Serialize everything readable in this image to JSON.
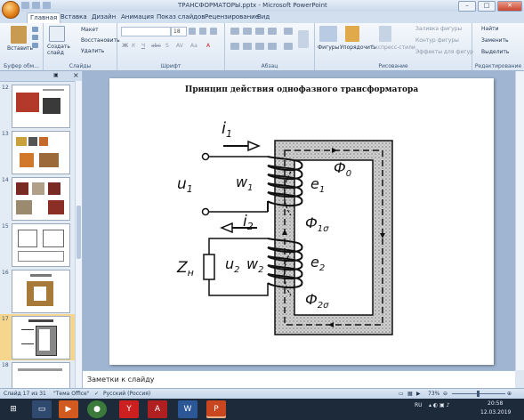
{
  "window": {
    "title": "ТРАНСФОРМАТОРЫ.pptx - Microsoft PowerPoint"
  },
  "tabs": [
    "Главная",
    "Вставка",
    "Дизайн",
    "Анимация",
    "Показ слайдов",
    "Рецензирование",
    "Вид"
  ],
  "ribbon": {
    "clipboard": {
      "paste": "Вставить",
      "group": "Буфер обм..."
    },
    "slides": {
      "create": "Создать слайд",
      "layout": "Макет",
      "reset": "Восстановить",
      "delete": "Удалить",
      "group": "Слайды"
    },
    "font": {
      "font_name": "",
      "font_size": "18",
      "group": "Шрифт"
    },
    "paragraph": {
      "group": "Абзац"
    },
    "drawing": {
      "shapes": "Фигуры",
      "arrange": "Упорядочить",
      "quick_styles": "Экспресс-стили",
      "fill": "Заливка фигуры",
      "outline": "Контур фигуры",
      "effects": "Эффекты для фигур",
      "group": "Рисование"
    },
    "editing": {
      "find": "Найти",
      "replace": "Заменить",
      "select": "Выделить",
      "group": "Редактирование"
    }
  },
  "slides_pane": {
    "items": [
      {
        "number": "12"
      },
      {
        "number": "13"
      },
      {
        "number": "14"
      },
      {
        "number": "15"
      },
      {
        "number": "16"
      },
      {
        "number": "17"
      },
      {
        "number": "18"
      }
    ]
  },
  "slide": {
    "title": "Принцип действия однофазного трансформатора",
    "labels": {
      "i1": "i",
      "i1_sub": "1",
      "u1": "u",
      "u1_sub": "1",
      "w1": "w",
      "w1_sub": "1",
      "e1": "e",
      "e1_sub": "1",
      "phi0": "Ф",
      "phi0_sub": "0",
      "phi1s": "Ф",
      "phi1s_sub": "1σ",
      "i2": "i",
      "i2_sub": "2",
      "zn": "Z",
      "zn_sub": "н",
      "u2": "u",
      "u2_sub": "2",
      "w2": "w",
      "w2_sub": "2",
      "e2": "e",
      "e2_sub": "2",
      "phi2s": "Ф",
      "phi2s_sub": "2σ"
    }
  },
  "notes": {
    "placeholder": "Заметки к слайду"
  },
  "status": {
    "slide_info": "Слайд 17 из 31",
    "theme": "\"Тема Office\"",
    "language": "Русский (Россия)",
    "zoom": "73%"
  },
  "taskbar": {
    "lang": "RU",
    "time": "20:58",
    "date": "12.03.2019"
  },
  "colors": {
    "accent": "#2a5f9e",
    "active_slide": "#f6d58c",
    "taskbar": "#1d2a3a"
  }
}
